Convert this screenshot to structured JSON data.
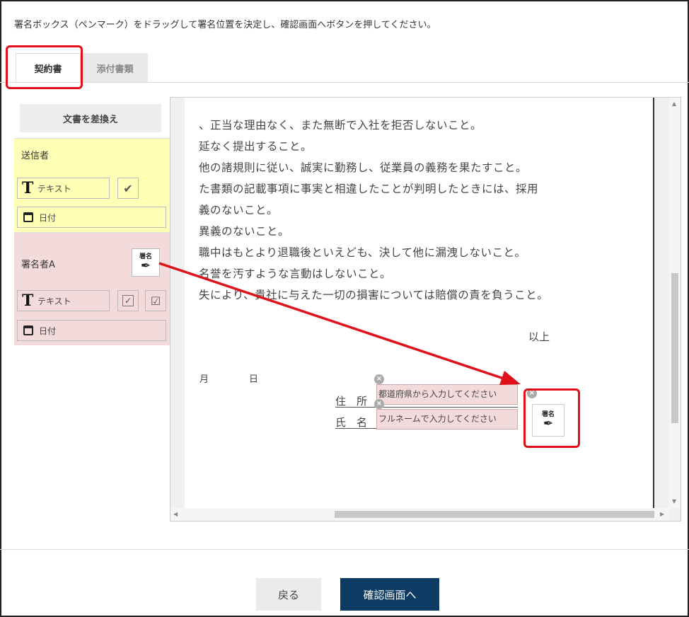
{
  "instruction": "署名ボックス（ペンマーク）をドラッグして署名位置を決定し、確認画面へボタンを押してください。",
  "tabs": [
    {
      "label": "契約書",
      "active": true
    },
    {
      "label": "添付書類",
      "active": false
    }
  ],
  "sidebar": {
    "replace_button": "文書を差換え",
    "sender": {
      "title": "送信者",
      "text_label": "テキスト",
      "date_label": "日付"
    },
    "signer": {
      "title": "署名者A",
      "sig_label": "署名",
      "text_label": "テキスト",
      "date_label": "日付"
    }
  },
  "document": {
    "lines": [
      "、正当な理由なく、また無断で入社を拒否しないこと。",
      "延なく提出すること。",
      "他の諸規則に従い、誠実に勤務し、従業員の義務を果たすこと。",
      "た書類の記載事項に事実と相違したことが判明したときには、採用",
      "義のないこと。",
      "異義のないこと。",
      "職中はもとより退職後といえども、決して他に漏洩しないこと。",
      "名誉を汚すような言動はしないこと。",
      "失により、貴社に与えた一切の損害については賠償の責を負うこと。"
    ],
    "closing": "以上",
    "month": "月",
    "day": "日",
    "address_label": "住　所",
    "name_label": "氏　名",
    "address_placeholder": "都道府県から入力してください",
    "name_placeholder": "フルネームで入力してください",
    "sig_label": "署名"
  },
  "footer": {
    "back": "戻る",
    "confirm": "確認画面へ"
  },
  "colors": {
    "highlight": "#e0101a",
    "sender_bg": "#ffffb6",
    "signer_bg": "#f4dbdb",
    "primary": "#0c3b63"
  }
}
